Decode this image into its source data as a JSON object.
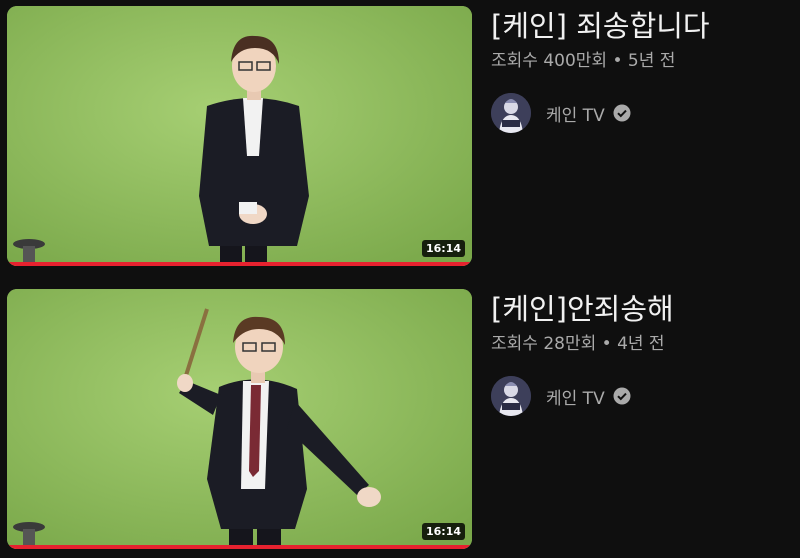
{
  "videos": [
    {
      "title": "[케인] 죄송합니다",
      "stats": "조회수 400만회 • 5년 전",
      "channel": "케인 TV",
      "duration": "16:14",
      "watched_fraction": 1.0,
      "thumbnail_icon": "person-standing-thumbnail"
    },
    {
      "title": "[케인]안죄송해",
      "stats": "조회수 28만회 • 4년 전",
      "channel": "케인 TV",
      "duration": "16:14",
      "watched_fraction": 1.0,
      "thumbnail_icon": "person-swinging-stick-thumbnail"
    }
  ],
  "colors": {
    "background": "#0f0f0f",
    "progress": "#e6222f",
    "greenscreen": "#8fbf5e",
    "secondary_text": "#aaaaaa"
  },
  "icons": {
    "verified": "verified-check-icon",
    "avatar": "channel-avatar-icon"
  }
}
